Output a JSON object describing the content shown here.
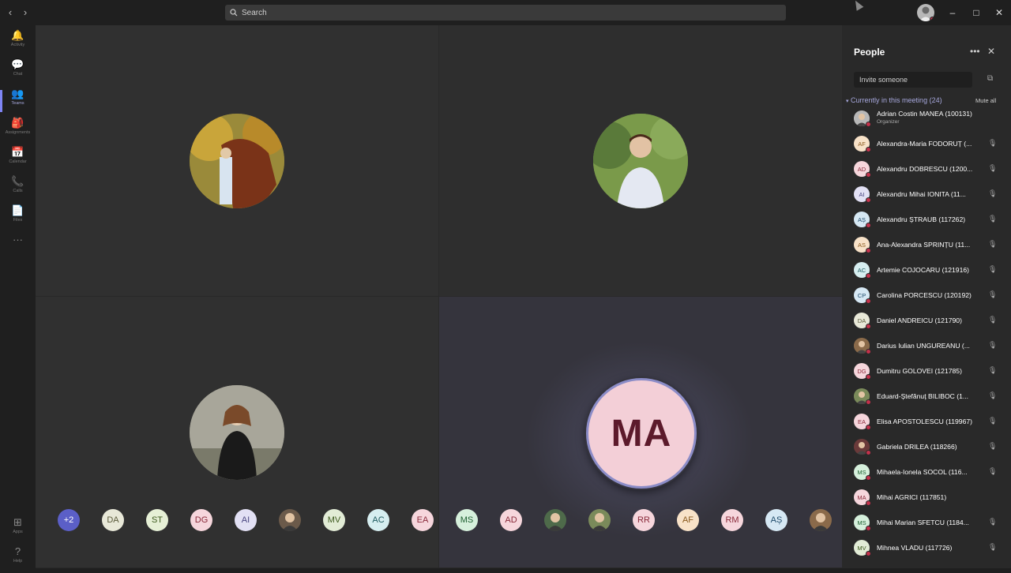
{
  "titlebar": {
    "search_label": "Search"
  },
  "rail": [
    {
      "label": "Activity",
      "icon": "bell-icon",
      "glyph": "🔔"
    },
    {
      "label": "Chat",
      "icon": "chat-icon",
      "glyph": "💬"
    },
    {
      "label": "Teams",
      "icon": "teams-icon",
      "glyph": "👥",
      "active": true
    },
    {
      "label": "Assignments",
      "icon": "assignments-icon",
      "glyph": "🎒"
    },
    {
      "label": "Calendar",
      "icon": "calendar-icon",
      "glyph": "📅"
    },
    {
      "label": "Calls",
      "icon": "phone-icon",
      "glyph": "📞"
    },
    {
      "label": "Files",
      "icon": "files-icon",
      "glyph": "📄"
    },
    {
      "label": "",
      "icon": "more-icon",
      "glyph": "···"
    }
  ],
  "rail_bottom": [
    {
      "label": "Apps",
      "icon": "apps-icon",
      "glyph": "⊞"
    },
    {
      "label": "Help",
      "icon": "help-icon",
      "glyph": "?"
    }
  ],
  "stage": {
    "active_initials": "MA"
  },
  "strip": [
    {
      "text": "+2",
      "bg": "#5b5fc7",
      "fg": "#ffffff"
    },
    {
      "text": "DA",
      "bg": "#e8e8d8",
      "fg": "#5a5a3a"
    },
    {
      "text": "ST",
      "bg": "#e6f0d6",
      "fg": "#3d5a1e"
    },
    {
      "text": "DG",
      "bg": "#f6d6dc",
      "fg": "#8a2a3a"
    },
    {
      "text": "AI",
      "bg": "#e2e0f4",
      "fg": "#4a4680"
    },
    {
      "text": "",
      "bg": "#6b5a4a",
      "fg": "#fff",
      "photo": true
    },
    {
      "text": "MV",
      "bg": "#e2ecd6",
      "fg": "#3d5a1e"
    },
    {
      "text": "AC",
      "bg": "#d6eef0",
      "fg": "#1e5a5f"
    },
    {
      "text": "EA",
      "bg": "#f6d6dc",
      "fg": "#8a2a3a"
    },
    {
      "text": "MS",
      "bg": "#d6f0dc",
      "fg": "#1e5f30"
    },
    {
      "text": "AD",
      "bg": "#f6d6dc",
      "fg": "#8a2a3a"
    },
    {
      "text": "",
      "bg": "#4e6a4a",
      "fg": "#fff",
      "photo": true
    },
    {
      "text": "",
      "bg": "#7a8a5a",
      "fg": "#fff",
      "photo": true
    },
    {
      "text": "RR",
      "bg": "#f6d6dc",
      "fg": "#8a2a3a"
    },
    {
      "text": "AF",
      "bg": "#f8e2c8",
      "fg": "#8a5a1e"
    },
    {
      "text": "RM",
      "bg": "#f6d6dc",
      "fg": "#8a2a3a"
    },
    {
      "text": "AȘ",
      "bg": "#d6e8f4",
      "fg": "#1e4a6a"
    },
    {
      "text": "",
      "bg": "#8a6a4a",
      "fg": "#fff",
      "photo": true
    }
  ],
  "people_panel": {
    "title": "People",
    "invite_placeholder": "Invite someone",
    "section_label": "Currently in this meeting (24)",
    "mute_all": "Mute all",
    "people": [
      {
        "name": "Adrian Costin MANEA (100131)",
        "role": "Organizer",
        "initials": "",
        "bg": "#b8b8b8",
        "fg": "#333",
        "photo": true,
        "mic": false
      },
      {
        "name": "Alexandra-Maria FODORUȚ (...",
        "initials": "AF",
        "bg": "#f8e2c8",
        "fg": "#8a5a1e",
        "mic": true
      },
      {
        "name": "Alexandru DOBRESCU (1200...",
        "initials": "AD",
        "bg": "#f6d6dc",
        "fg": "#8a2a3a",
        "mic": true
      },
      {
        "name": "Alexandru Mihai IONITA (11...",
        "initials": "AI",
        "bg": "#e2e0f4",
        "fg": "#4a4680",
        "mic": true
      },
      {
        "name": "Alexandru ȘTRAUB (117262)",
        "initials": "AȘ",
        "bg": "#d6e8f4",
        "fg": "#1e4a6a",
        "mic": true
      },
      {
        "name": "Ana-Alexandra SPRINȚU (11...",
        "initials": "AS",
        "bg": "#f8e2c8",
        "fg": "#8a5a1e",
        "mic": true
      },
      {
        "name": "Artemie COJOCARU (121916)",
        "initials": "AC",
        "bg": "#d6eef0",
        "fg": "#1e5a5f",
        "mic": true
      },
      {
        "name": "Carolina PORCESCU (120192)",
        "initials": "CP",
        "bg": "#d6e8f4",
        "fg": "#1e4a6a",
        "mic": true
      },
      {
        "name": "Daniel ANDREICU (121790)",
        "initials": "DA",
        "bg": "#e8e8d8",
        "fg": "#5a5a3a",
        "mic": true
      },
      {
        "name": "Darius Iulian UNGUREANU (...",
        "initials": "",
        "bg": "#8a6a4a",
        "fg": "#fff",
        "photo": true,
        "mic": true
      },
      {
        "name": "Dumitru GOLOVEI (121785)",
        "initials": "DG",
        "bg": "#f6d6dc",
        "fg": "#8a2a3a",
        "mic": true
      },
      {
        "name": "Eduard-Ștefănuț BILIBOC (1...",
        "initials": "",
        "bg": "#7a8a5a",
        "fg": "#fff",
        "photo": true,
        "mic": true
      },
      {
        "name": "Elisa APOSTOLESCU (119967)",
        "initials": "EA",
        "bg": "#f6d6dc",
        "fg": "#8a2a3a",
        "mic": true
      },
      {
        "name": "Gabriela DRILEA (118266)",
        "initials": "",
        "bg": "#6a3a3a",
        "fg": "#fff",
        "photo": true,
        "mic": true
      },
      {
        "name": "Mihaela-Ionela SOCOL (116...",
        "initials": "MS",
        "bg": "#d6f0dc",
        "fg": "#1e5f30",
        "mic": true
      },
      {
        "name": "Mihai AGRICI (117851)",
        "initials": "MA",
        "bg": "#f6d6dc",
        "fg": "#8a2a3a",
        "mic": false
      },
      {
        "name": "Mihai Marian SFETCU (1184...",
        "initials": "MS",
        "bg": "#d6f0dc",
        "fg": "#1e5f30",
        "mic": true
      },
      {
        "name": "Mihnea VLADU (117726)",
        "initials": "MV",
        "bg": "#e2ecd6",
        "fg": "#3d5a1e",
        "mic": true
      }
    ]
  }
}
